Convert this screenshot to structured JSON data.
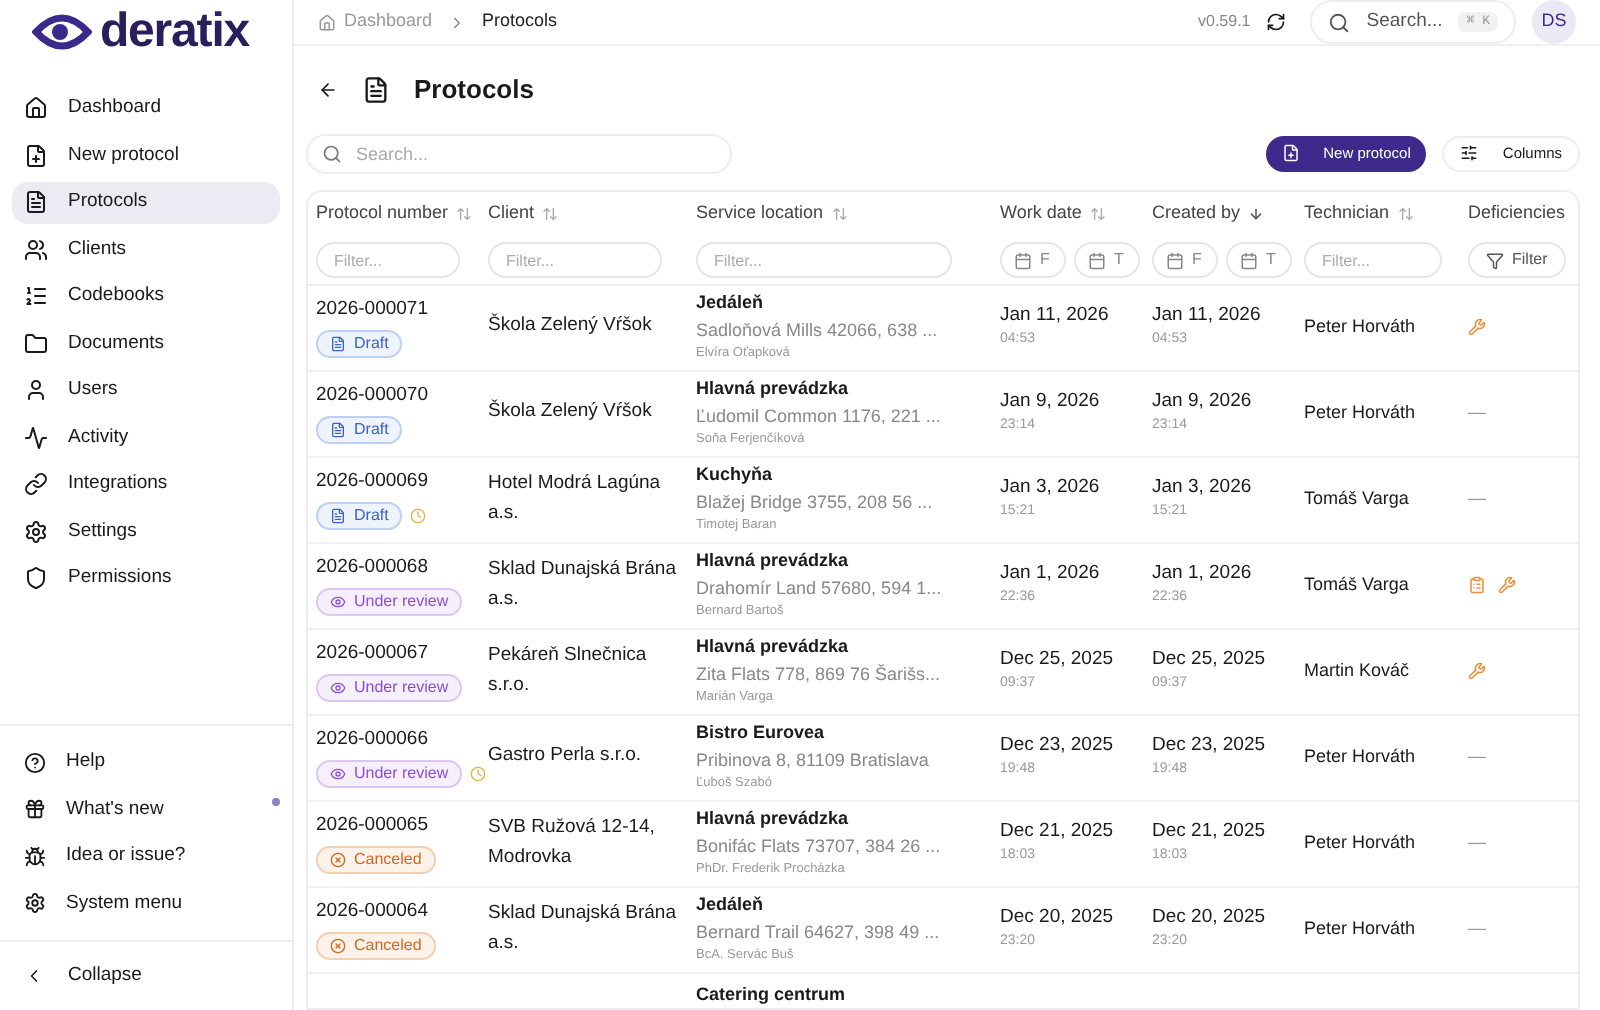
{
  "logo": {
    "text": "deratix"
  },
  "breadcrumb": [
    {
      "label": "Dashboard",
      "selected": false
    },
    {
      "label": "Protocols",
      "selected": true
    }
  ],
  "header": {
    "version": "v0.59.1",
    "search": {
      "placeholder": "Search...",
      "shortcut": "⌘ K"
    },
    "avatar": "DS"
  },
  "sidebar": {
    "items": [
      {
        "label": "Dashboard",
        "selected": false
      },
      {
        "label": "New protocol",
        "selected": false
      },
      {
        "label": "Protocols",
        "selected": true
      },
      {
        "label": "Clients",
        "selected": false
      },
      {
        "label": "Codebooks",
        "selected": false
      },
      {
        "label": "Documents",
        "selected": false
      },
      {
        "label": "Users",
        "selected": false
      },
      {
        "label": "Activity",
        "selected": false
      },
      {
        "label": "Integrations",
        "selected": false
      },
      {
        "label": "Settings",
        "selected": false
      },
      {
        "label": "Permissions",
        "selected": false
      }
    ],
    "bottom_items": [
      {
        "label": "Help",
        "unread": false
      },
      {
        "label": "What's new",
        "unread": true
      },
      {
        "label": "Idea or issue?",
        "unread": false
      },
      {
        "label": "System menu",
        "unread": false
      }
    ],
    "collapse": "Collapse"
  },
  "page": {
    "title": "Protocols",
    "search": {
      "placeholder": "Search..."
    },
    "new_button": "New protocol",
    "columns_button": "Columns"
  },
  "table": {
    "columns": [
      {
        "label": "Protocol number",
        "sorted": false,
        "filter": {
          "kind": "text",
          "placeholder": "Filter..."
        }
      },
      {
        "label": "Client",
        "sorted": false,
        "filter": {
          "kind": "text",
          "placeholder": "Filter..."
        }
      },
      {
        "label": "Service location",
        "sorted": false,
        "filter": {
          "kind": "text",
          "placeholder": "Filter..."
        }
      },
      {
        "label": "Work date",
        "sorted": false,
        "filter": {
          "kind": "dates",
          "from": "F",
          "to": "T"
        }
      },
      {
        "label": "Created by",
        "sorted": true,
        "filter": {
          "kind": "dates",
          "from": "F",
          "to": "T"
        }
      },
      {
        "label": "Technician",
        "sorted": false,
        "filter": {
          "kind": "text",
          "placeholder": "Filter..."
        }
      },
      {
        "label": "Deficiencies",
        "filter": {
          "kind": "button",
          "label": "Filter"
        }
      }
    ],
    "rows": [
      {
        "number": "2026-000071",
        "status": {
          "kind": "draft",
          "label": "Draft"
        },
        "pending": false,
        "client": "Škola Zelený Vŕšok",
        "location": "Jedáleň",
        "address": "Sadloňová Mills 42066, 638 ...",
        "contact": "Elvíra Oťapková",
        "work_date": "Jan 11, 2026",
        "work_time": "04:53",
        "created_date": "Jan 11, 2026",
        "created_time": "04:53",
        "technician": "Peter Horváth",
        "clipboard": false,
        "wrench": true
      },
      {
        "number": "2026-000070",
        "status": {
          "kind": "draft",
          "label": "Draft"
        },
        "pending": false,
        "client": "Škola Zelený Vŕšok",
        "location": "Hlavná prevádzka",
        "address": "Ľudomil Common 1176, 221 ...",
        "contact": "Soňa Ferjenčíková",
        "work_date": "Jan 9, 2026",
        "work_time": "23:14",
        "created_date": "Jan 9, 2026",
        "created_time": "23:14",
        "technician": "Peter Horváth",
        "clipboard": false,
        "wrench": false,
        "none_text": "—"
      },
      {
        "number": "2026-000069",
        "status": {
          "kind": "draft",
          "label": "Draft"
        },
        "pending": true,
        "client": "Hotel Modrá Lagúna a.s.",
        "location": "Kuchyňa",
        "address": "Blažej Bridge 3755, 208 56 ...",
        "contact": "Timotej Baran",
        "work_date": "Jan 3, 2026",
        "work_time": "15:21",
        "created_date": "Jan 3, 2026",
        "created_time": "15:21",
        "technician": "Tomáš Varga",
        "clipboard": false,
        "wrench": false,
        "none_text": "—"
      },
      {
        "number": "2026-000068",
        "status": {
          "kind": "review",
          "label": "Under review"
        },
        "pending": false,
        "client": "Sklad Dunajská Brána a.s.",
        "location": "Hlavná prevádzka",
        "address": "Drahomír Land 57680, 594 1...",
        "contact": "Bernard Bartoš",
        "work_date": "Jan 1, 2026",
        "work_time": "22:36",
        "created_date": "Jan 1, 2026",
        "created_time": "22:36",
        "technician": "Tomáš Varga",
        "clipboard": true,
        "wrench": true
      },
      {
        "number": "2026-000067",
        "status": {
          "kind": "review",
          "label": "Under review"
        },
        "pending": false,
        "client": "Pekáreň Slnečnica s.r.o.",
        "location": "Hlavná prevádzka",
        "address": "Zita Flats 778, 869 76 Šarišs...",
        "contact": "Marián Varga",
        "work_date": "Dec 25, 2025",
        "work_time": "09:37",
        "created_date": "Dec 25, 2025",
        "created_time": "09:37",
        "technician": "Martin Kováč",
        "clipboard": false,
        "wrench": true
      },
      {
        "number": "2026-000066",
        "status": {
          "kind": "review",
          "label": "Under review"
        },
        "pending": true,
        "client": "Gastro Perla s.r.o.",
        "location": "Bistro Eurovea",
        "address": "Pribinova 8, 81109 Bratislava",
        "contact": "Ľuboš Szabó",
        "work_date": "Dec 23, 2025",
        "work_time": "19:48",
        "created_date": "Dec 23, 2025",
        "created_time": "19:48",
        "technician": "Peter Horváth",
        "clipboard": false,
        "wrench": false,
        "none_text": "—"
      },
      {
        "number": "2026-000065",
        "status": {
          "kind": "canceled",
          "label": "Canceled"
        },
        "pending": false,
        "client": "SVB Ružová 12-14, Modrovka",
        "location": "Hlavná prevádzka",
        "address": "Bonifác Flats 73707, 384 26 ...",
        "contact": "PhDr. Frederik Procházka",
        "work_date": "Dec 21, 2025",
        "work_time": "18:03",
        "created_date": "Dec 21, 2025",
        "created_time": "18:03",
        "technician": "Peter Horváth",
        "clipboard": false,
        "wrench": false,
        "none_text": "—"
      },
      {
        "number": "2026-000064",
        "status": {
          "kind": "canceled",
          "label": "Canceled"
        },
        "pending": false,
        "client": "Sklad Dunajská Brána a.s.",
        "location": "Jedáleň",
        "address": "Bernard Trail 64627, 398 49 ...",
        "contact": "BcA. Servác Buš",
        "work_date": "Dec 20, 2025",
        "work_time": "23:20",
        "created_date": "Dec 20, 2025",
        "created_time": "23:20",
        "technician": "Peter Horváth",
        "clipboard": false,
        "wrench": false,
        "none_text": "—"
      }
    ],
    "partial_row": {
      "location": "Catering centrum"
    }
  }
}
